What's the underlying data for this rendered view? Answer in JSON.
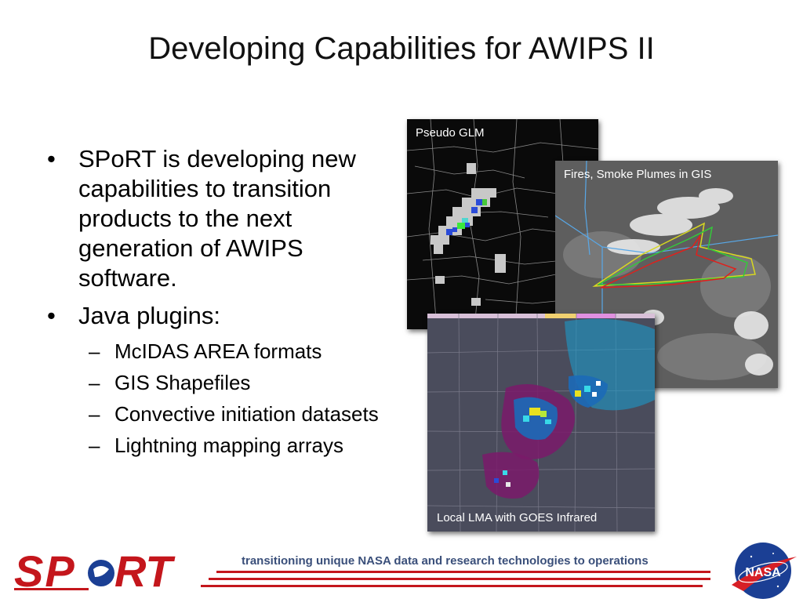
{
  "slide": {
    "title": "Developing Capabilities for AWIPS II",
    "bullets": [
      {
        "text": "SPoRT is developing new capabilities to transition products to the next generation of AWIPS software."
      },
      {
        "text": "Java plugins:"
      }
    ],
    "sub_bullets": [
      "McIDAS AREA formats",
      "GIS Shapefiles",
      "Convective initiation datasets",
      "Lightning mapping arrays"
    ],
    "bullet_glyph": "•",
    "dash_glyph": "–"
  },
  "images": {
    "glm_label": "Pseudo GLM",
    "fires_label": "Fires, Smoke Plumes in GIS",
    "lma_label": "Local LMA with GOES Infrared"
  },
  "footer": {
    "tagline": "transitioning unique NASA data and research technologies to operations",
    "sport_logo_text": "SPoRT",
    "nasa_logo_text": "NASA"
  },
  "colors": {
    "accent_red": "#c4161c",
    "footer_text": "#3a4f7a",
    "nasa_blue": "#1b3f94"
  }
}
